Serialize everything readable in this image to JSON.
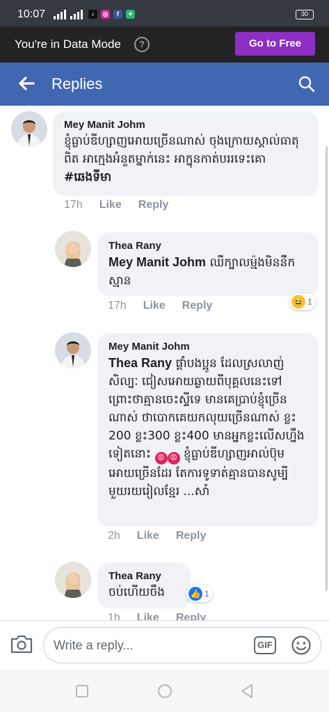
{
  "status_bar": {
    "time": "10:07",
    "battery": "30"
  },
  "data_mode": {
    "text": "You're in Data Mode",
    "help_icon": "?",
    "button": "Go to Free"
  },
  "header": {
    "title": "Replies"
  },
  "colors": {
    "header_blue": "#4267b2",
    "go_free_purple": "#8e2fc4",
    "bubble_gray": "#f0f2f5"
  },
  "comments": [
    {
      "author": "Mey Manit Johm",
      "text": "ខ្ញុំធ្លាប់ឌីហ្សាញអោយច្រើនណាស់ ចុងក្រោយស្គាល់ធាតុពិត អាក្មេងអំនួតម្នាក់នេះ អាក្នុនកាត់បររទេះគោ",
      "hashtag": "#ឆេងទីមា",
      "time": "17h",
      "like": "Like",
      "reply": "Reply"
    },
    {
      "author": "Thea Rany",
      "mention": "Mey Manit Johm",
      "text": "ឈឺក្បាលម៉្មងមិននឹកស្មាន",
      "time": "17h",
      "like": "Like",
      "reply": "Reply",
      "reaction_icon": "laughing-emoji-icon",
      "reaction_count": "1"
    },
    {
      "author": "Mey Manit Johm",
      "mention": "Thea Rany",
      "text": "ផ្តាំបងប្អូន ដែលស្រលាញ់សិល្បៈ ជៀសអោយឆ្ងាយពីបុគ្គលនេះទៅ ព្រោះថាគ្មានចេះស្ទីទេ មានគេប្រាប់ខ្ញុំច្រើនណាស់ ថាបោកគេយកលុយច្រើនណាស់ ខ្លះ 200 ខ្លះ300 ខ្លះ400 មានអ្នកខ្លះលើសហ្នឹងទៀតនោះ",
      "text_after": "ខ្ញុំធ្លាប់ឌីហ្សាញអាល់ប៊ុមអោយច្រើនដែរ តែការទូទាត់គ្មានបានសូម្បីមួយរយរៀលខ្មែរ ...សាំ",
      "time": "2h",
      "like": "Like",
      "reply": "Reply"
    },
    {
      "author": "Thea Rany",
      "text": "ចប់ហើយចឹង",
      "time": "1h",
      "like": "Like",
      "reply": "Reply",
      "reaction_icon": "thumbs-up-icon",
      "reaction_count": "1"
    }
  ],
  "compose": {
    "placeholder": "Write a reply...",
    "gif": "GIF"
  }
}
